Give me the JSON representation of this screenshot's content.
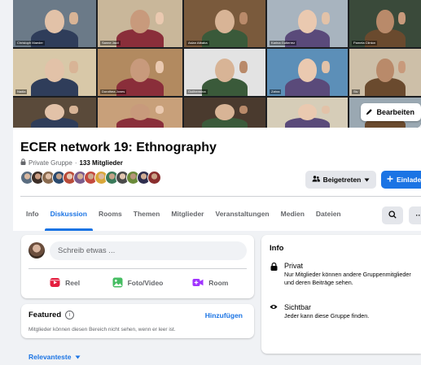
{
  "cover": {
    "participants": [
      {
        "name": "Christoph Maeder"
      },
      {
        "name": "Sanne Jacil"
      },
      {
        "name": "Aslan Atbaba"
      },
      {
        "name": "Karina Gutierrez"
      },
      {
        "name": "Pamela Clinton"
      },
      {
        "name": "Nadia"
      },
      {
        "name": "Dorothea Jones"
      },
      {
        "name": "Guilhermina"
      },
      {
        "name": "Zahra"
      },
      {
        "name": "Siv"
      },
      {
        "name": "Nadia"
      },
      {
        "name": "Dirk Fuchs"
      },
      {
        "name": "mallachan"
      },
      {
        "name": "Susan Bridges"
      },
      {
        "name": "Ignacio Reggio Caino"
      }
    ],
    "edit_label": "Bearbeiten"
  },
  "group": {
    "title": "ECER network 19: Ethnography",
    "privacy": "Private Gruppe",
    "separator": "·",
    "members": "133 Mitglieder"
  },
  "actions": {
    "joined_label": "Beigetreten",
    "invite_label": "Einladen"
  },
  "tabs": [
    {
      "label": "Info"
    },
    {
      "label": "Diskussion"
    },
    {
      "label": "Rooms"
    },
    {
      "label": "Themen"
    },
    {
      "label": "Mitglieder"
    },
    {
      "label": "Veranstaltungen"
    },
    {
      "label": "Medien"
    },
    {
      "label": "Dateien"
    }
  ],
  "more_label": "···",
  "composer": {
    "placeholder": "Schreib etwas ...",
    "actions": [
      {
        "label": "Reel",
        "icon": "reel-icon",
        "color": "#e41e3f"
      },
      {
        "label": "Foto/Video",
        "icon": "photo-icon",
        "color": "#45bd62"
      },
      {
        "label": "Room",
        "icon": "room-icon",
        "color": "#a033ff"
      }
    ]
  },
  "featured": {
    "title": "Featured",
    "add_label": "Hinzufügen",
    "note": "Mitglieder können diesen Bereich nicht sehen, wenn er leer ist."
  },
  "sort_label": "Relevanteste",
  "info": {
    "title": "Info",
    "private_heading": "Privat",
    "private_desc": "Nur Mitglieder können andere Gruppenmitglieder und deren Beiträge sehen.",
    "visible_heading": "Sichtbar",
    "visible_desc": "Jeder kann diese Gruppe finden."
  },
  "colors": {
    "accent": "#1b74e4",
    "background": "#f0f2f5",
    "secondary_button": "#e4e6eb"
  }
}
